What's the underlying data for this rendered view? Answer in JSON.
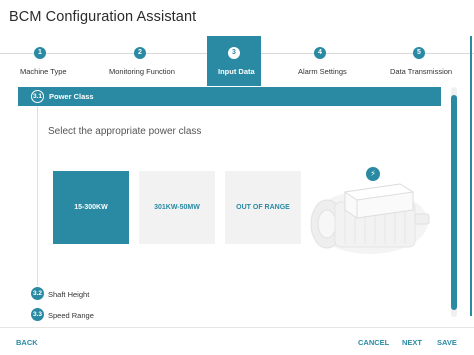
{
  "app": {
    "title": "BCM Configuration Assistant"
  },
  "stepper": {
    "steps": [
      {
        "num": "1",
        "label": "Machine Type"
      },
      {
        "num": "2",
        "label": "Monitoring Function"
      },
      {
        "num": "3",
        "label": "Input Data"
      },
      {
        "num": "4",
        "label": "Alarm Settings"
      },
      {
        "num": "5",
        "label": "Data Transmission"
      }
    ],
    "active_index": 2
  },
  "section": {
    "num": "3.1",
    "title": "Power Class",
    "prompt": "Select the appropriate power class"
  },
  "options": [
    {
      "label": "15-300KW",
      "selected": true
    },
    {
      "label": "301KW-50MW",
      "selected": false
    },
    {
      "label": "OUT OF RANGE",
      "selected": false
    }
  ],
  "illustration": {
    "pin_icon": "power-bolt-icon"
  },
  "subsections": [
    {
      "num": "3.2",
      "label": "Shaft Height"
    },
    {
      "num": "3.3",
      "label": "Speed Range"
    }
  ],
  "footer": {
    "back": "BACK",
    "cancel": "CANCEL",
    "next": "NEXT",
    "save": "SAVE"
  },
  "colors": {
    "accent": "#2a8aa3",
    "card_bg": "#f2f2f2"
  }
}
